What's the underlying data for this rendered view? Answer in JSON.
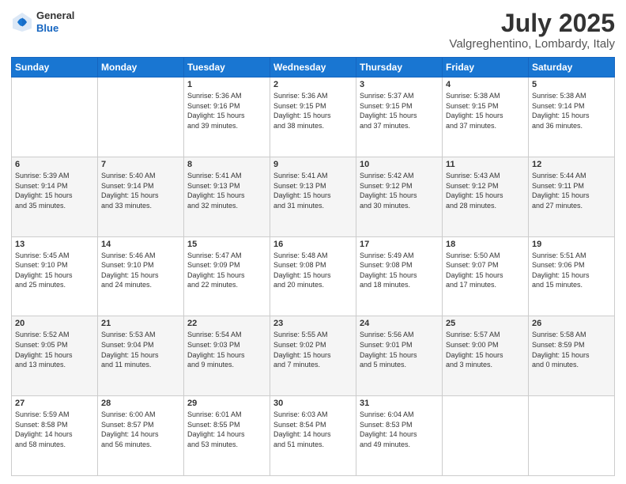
{
  "header": {
    "logo": {
      "line1": "General",
      "line2": "Blue"
    },
    "title": "July 2025",
    "location": "Valgreghentino, Lombardy, Italy"
  },
  "calendar": {
    "headers": [
      "Sunday",
      "Monday",
      "Tuesday",
      "Wednesday",
      "Thursday",
      "Friday",
      "Saturday"
    ],
    "weeks": [
      [
        {
          "day": "",
          "info": ""
        },
        {
          "day": "",
          "info": ""
        },
        {
          "day": "1",
          "info": "Sunrise: 5:36 AM\nSunset: 9:16 PM\nDaylight: 15 hours\nand 39 minutes."
        },
        {
          "day": "2",
          "info": "Sunrise: 5:36 AM\nSunset: 9:15 PM\nDaylight: 15 hours\nand 38 minutes."
        },
        {
          "day": "3",
          "info": "Sunrise: 5:37 AM\nSunset: 9:15 PM\nDaylight: 15 hours\nand 37 minutes."
        },
        {
          "day": "4",
          "info": "Sunrise: 5:38 AM\nSunset: 9:15 PM\nDaylight: 15 hours\nand 37 minutes."
        },
        {
          "day": "5",
          "info": "Sunrise: 5:38 AM\nSunset: 9:14 PM\nDaylight: 15 hours\nand 36 minutes."
        }
      ],
      [
        {
          "day": "6",
          "info": "Sunrise: 5:39 AM\nSunset: 9:14 PM\nDaylight: 15 hours\nand 35 minutes."
        },
        {
          "day": "7",
          "info": "Sunrise: 5:40 AM\nSunset: 9:14 PM\nDaylight: 15 hours\nand 33 minutes."
        },
        {
          "day": "8",
          "info": "Sunrise: 5:41 AM\nSunset: 9:13 PM\nDaylight: 15 hours\nand 32 minutes."
        },
        {
          "day": "9",
          "info": "Sunrise: 5:41 AM\nSunset: 9:13 PM\nDaylight: 15 hours\nand 31 minutes."
        },
        {
          "day": "10",
          "info": "Sunrise: 5:42 AM\nSunset: 9:12 PM\nDaylight: 15 hours\nand 30 minutes."
        },
        {
          "day": "11",
          "info": "Sunrise: 5:43 AM\nSunset: 9:12 PM\nDaylight: 15 hours\nand 28 minutes."
        },
        {
          "day": "12",
          "info": "Sunrise: 5:44 AM\nSunset: 9:11 PM\nDaylight: 15 hours\nand 27 minutes."
        }
      ],
      [
        {
          "day": "13",
          "info": "Sunrise: 5:45 AM\nSunset: 9:10 PM\nDaylight: 15 hours\nand 25 minutes."
        },
        {
          "day": "14",
          "info": "Sunrise: 5:46 AM\nSunset: 9:10 PM\nDaylight: 15 hours\nand 24 minutes."
        },
        {
          "day": "15",
          "info": "Sunrise: 5:47 AM\nSunset: 9:09 PM\nDaylight: 15 hours\nand 22 minutes."
        },
        {
          "day": "16",
          "info": "Sunrise: 5:48 AM\nSunset: 9:08 PM\nDaylight: 15 hours\nand 20 minutes."
        },
        {
          "day": "17",
          "info": "Sunrise: 5:49 AM\nSunset: 9:08 PM\nDaylight: 15 hours\nand 18 minutes."
        },
        {
          "day": "18",
          "info": "Sunrise: 5:50 AM\nSunset: 9:07 PM\nDaylight: 15 hours\nand 17 minutes."
        },
        {
          "day": "19",
          "info": "Sunrise: 5:51 AM\nSunset: 9:06 PM\nDaylight: 15 hours\nand 15 minutes."
        }
      ],
      [
        {
          "day": "20",
          "info": "Sunrise: 5:52 AM\nSunset: 9:05 PM\nDaylight: 15 hours\nand 13 minutes."
        },
        {
          "day": "21",
          "info": "Sunrise: 5:53 AM\nSunset: 9:04 PM\nDaylight: 15 hours\nand 11 minutes."
        },
        {
          "day": "22",
          "info": "Sunrise: 5:54 AM\nSunset: 9:03 PM\nDaylight: 15 hours\nand 9 minutes."
        },
        {
          "day": "23",
          "info": "Sunrise: 5:55 AM\nSunset: 9:02 PM\nDaylight: 15 hours\nand 7 minutes."
        },
        {
          "day": "24",
          "info": "Sunrise: 5:56 AM\nSunset: 9:01 PM\nDaylight: 15 hours\nand 5 minutes."
        },
        {
          "day": "25",
          "info": "Sunrise: 5:57 AM\nSunset: 9:00 PM\nDaylight: 15 hours\nand 3 minutes."
        },
        {
          "day": "26",
          "info": "Sunrise: 5:58 AM\nSunset: 8:59 PM\nDaylight: 15 hours\nand 0 minutes."
        }
      ],
      [
        {
          "day": "27",
          "info": "Sunrise: 5:59 AM\nSunset: 8:58 PM\nDaylight: 14 hours\nand 58 minutes."
        },
        {
          "day": "28",
          "info": "Sunrise: 6:00 AM\nSunset: 8:57 PM\nDaylight: 14 hours\nand 56 minutes."
        },
        {
          "day": "29",
          "info": "Sunrise: 6:01 AM\nSunset: 8:55 PM\nDaylight: 14 hours\nand 53 minutes."
        },
        {
          "day": "30",
          "info": "Sunrise: 6:03 AM\nSunset: 8:54 PM\nDaylight: 14 hours\nand 51 minutes."
        },
        {
          "day": "31",
          "info": "Sunrise: 6:04 AM\nSunset: 8:53 PM\nDaylight: 14 hours\nand 49 minutes."
        },
        {
          "day": "",
          "info": ""
        },
        {
          "day": "",
          "info": ""
        }
      ]
    ]
  }
}
